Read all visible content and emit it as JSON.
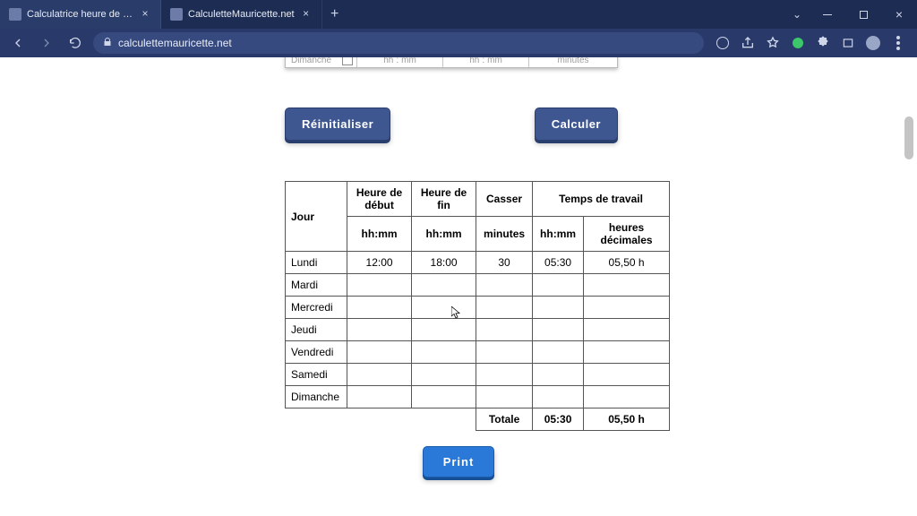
{
  "browser": {
    "tabs": [
      {
        "title": "Calculatrice heure de travail - Cal"
      },
      {
        "title": "CalculetteMauricette.net"
      }
    ],
    "url": "calculettemauricette.net"
  },
  "top_inputs": {
    "day_label": "Dimanche",
    "hh": "hh",
    "mm": "mm",
    "minutes": "minutes"
  },
  "buttons": {
    "reset": "Réinitialiser",
    "calc": "Calculer",
    "print": "Print"
  },
  "table": {
    "headers": {
      "jour": "Jour",
      "start": "Heure de début",
      "end": "Heure de fin",
      "break": "Casser",
      "work": "Temps de travail",
      "hhmm": "hh:mm",
      "minutes": "minutes",
      "dec": "heures décimales"
    },
    "rows": [
      {
        "jour": "Lundi",
        "start": "12:00",
        "end": "18:00",
        "break": "30",
        "hhmm": "05:30",
        "dec": "05,50 h"
      },
      {
        "jour": "Mardi",
        "start": "",
        "end": "",
        "break": "",
        "hhmm": "",
        "dec": ""
      },
      {
        "jour": "Mercredi",
        "start": "",
        "end": "",
        "break": "",
        "hhmm": "",
        "dec": ""
      },
      {
        "jour": "Jeudi",
        "start": "",
        "end": "",
        "break": "",
        "hhmm": "",
        "dec": ""
      },
      {
        "jour": "Vendredi",
        "start": "",
        "end": "",
        "break": "",
        "hhmm": "",
        "dec": ""
      },
      {
        "jour": "Samedi",
        "start": "",
        "end": "",
        "break": "",
        "hhmm": "",
        "dec": ""
      },
      {
        "jour": "Dimanche",
        "start": "",
        "end": "",
        "break": "",
        "hhmm": "",
        "dec": ""
      }
    ],
    "total": {
      "label": "Totale",
      "hhmm": "05:30",
      "dec": "05,50 h"
    }
  }
}
